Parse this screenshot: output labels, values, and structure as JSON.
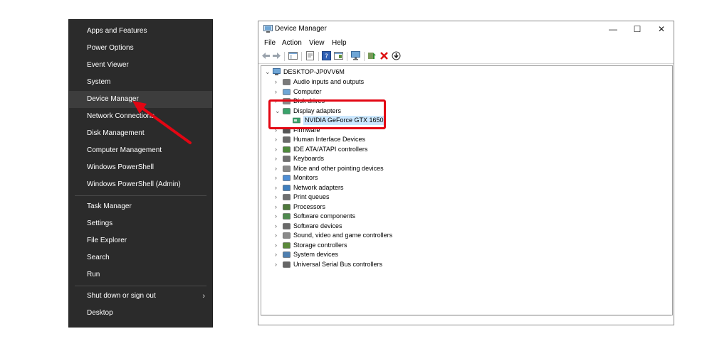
{
  "winx_menu": {
    "groups": [
      [
        "Apps and Features",
        "Power Options",
        "Event Viewer",
        "System",
        "Device Manager",
        "Network Connections",
        "Disk Management",
        "Computer Management",
        "Windows PowerShell",
        "Windows PowerShell (Admin)"
      ],
      [
        "Task Manager",
        "Settings",
        "File Explorer",
        "Search",
        "Run"
      ],
      [
        "Shut down or sign out",
        "Desktop"
      ]
    ],
    "selected": "Device Manager",
    "shutdown_chevron": "›"
  },
  "device_manager": {
    "title": "Device Manager",
    "menu": [
      "File",
      "Action",
      "View",
      "Help"
    ],
    "window_buttons": {
      "minimize": "—",
      "maximize": "☐",
      "close": "✕"
    },
    "root": "DESKTOP-JP0VV6M",
    "categories": [
      {
        "label": "Audio inputs and outputs",
        "icon": "speaker-icon"
      },
      {
        "label": "Computer",
        "icon": "computer-icon"
      },
      {
        "label": "Disk drives",
        "icon": "disk-icon"
      },
      {
        "label": "Display adapters",
        "icon": "display-adapter-icon",
        "expanded": true,
        "children": [
          "NVIDIA GeForce GTX 1650"
        ]
      },
      {
        "label": "Firmware",
        "icon": "firmware-icon"
      },
      {
        "label": "Human Interface Devices",
        "icon": "hid-icon"
      },
      {
        "label": "IDE ATA/ATAPI controllers",
        "icon": "ide-icon"
      },
      {
        "label": "Keyboards",
        "icon": "keyboard-icon"
      },
      {
        "label": "Mice and other pointing devices",
        "icon": "mouse-icon"
      },
      {
        "label": "Monitors",
        "icon": "monitor-icon"
      },
      {
        "label": "Network adapters",
        "icon": "network-icon"
      },
      {
        "label": "Print queues",
        "icon": "printer-icon"
      },
      {
        "label": "Processors",
        "icon": "processor-icon"
      },
      {
        "label": "Software components",
        "icon": "software-component-icon"
      },
      {
        "label": "Software devices",
        "icon": "software-device-icon"
      },
      {
        "label": "Sound, video and game controllers",
        "icon": "sound-icon"
      },
      {
        "label": "Storage controllers",
        "icon": "storage-icon"
      },
      {
        "label": "System devices",
        "icon": "system-device-icon"
      },
      {
        "label": "Universal Serial Bus controllers",
        "icon": "usb-icon"
      }
    ]
  },
  "colors": {
    "annotation": "#e30613",
    "menu_bg": "#2b2b2b",
    "selection": "#cce8ff"
  }
}
